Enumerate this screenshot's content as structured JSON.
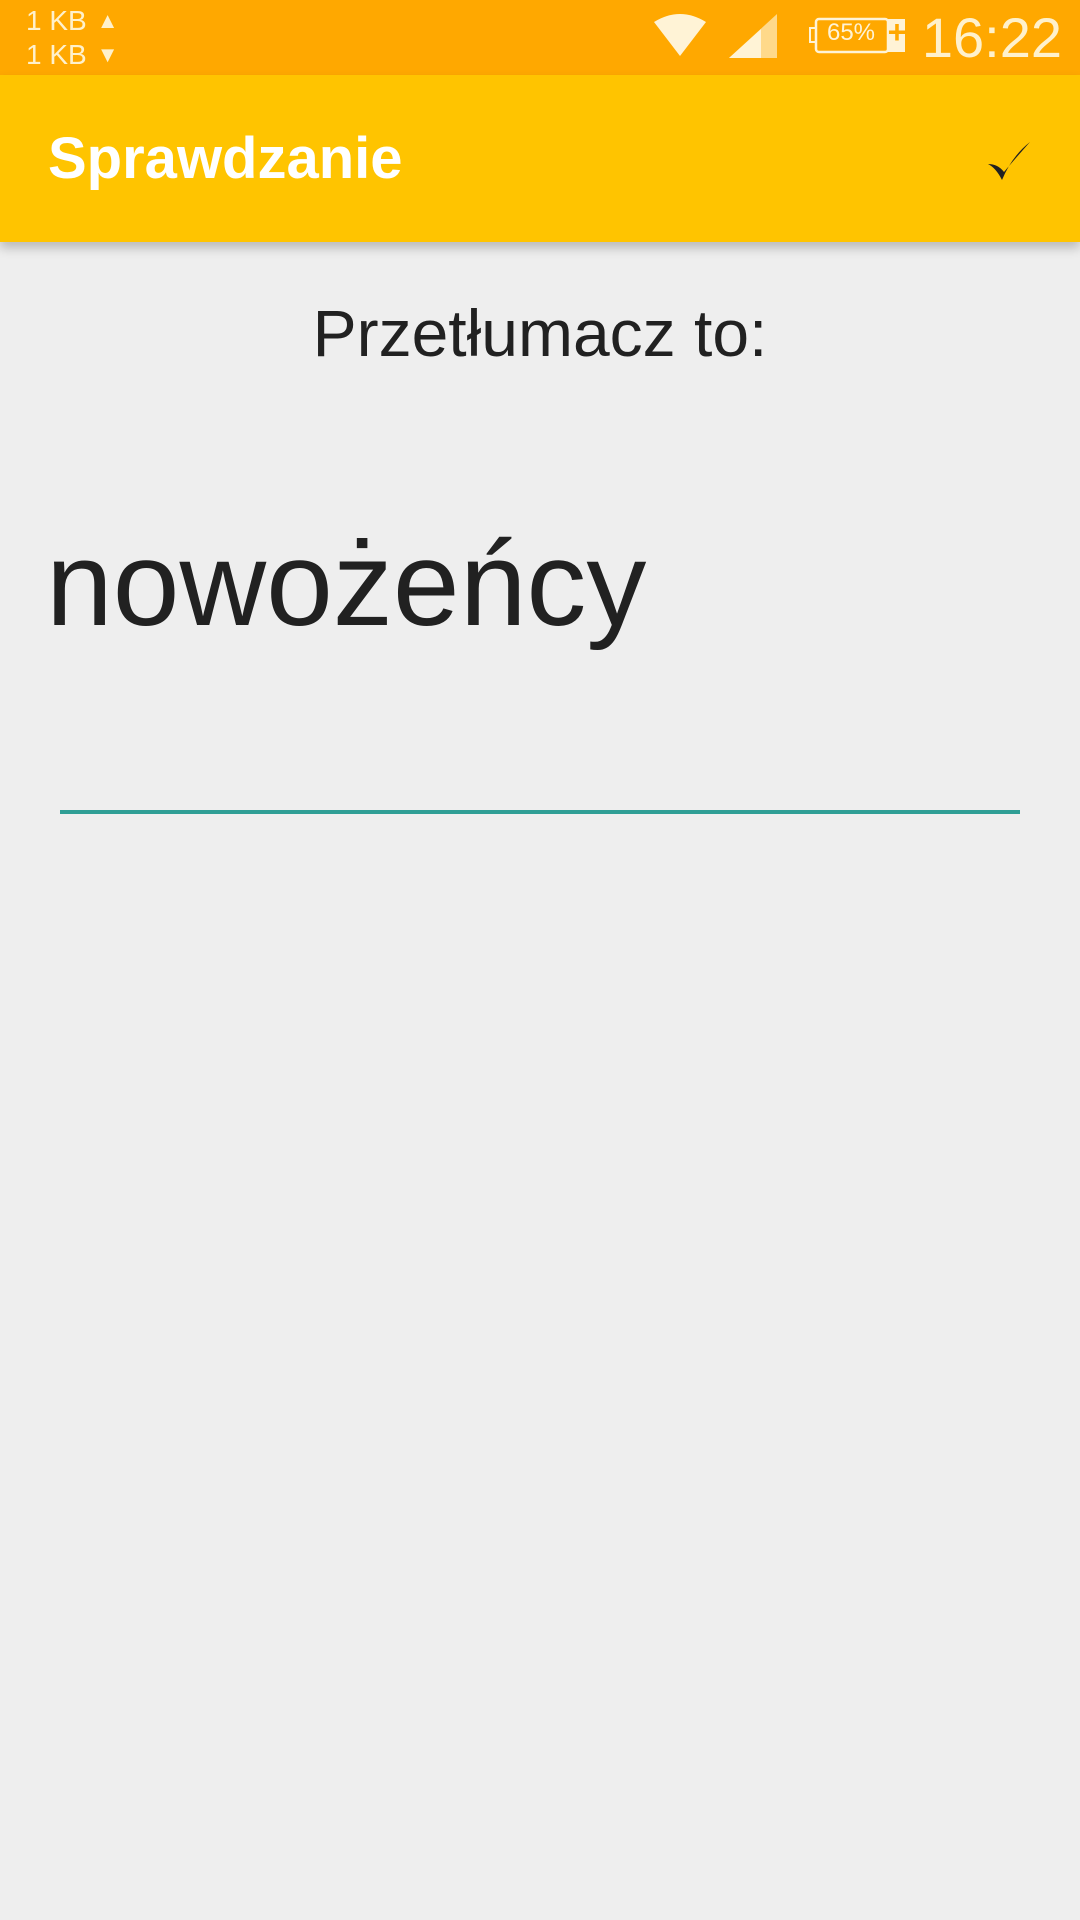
{
  "status_bar": {
    "upload_speed": "1 KB",
    "download_speed": "1 KB",
    "upload_arrow": "▲",
    "download_arrow": "▼",
    "battery_level": "65%",
    "battery_charging_symbol": "+",
    "time": "16:22",
    "icons": [
      "wifi-icon",
      "signal-icon",
      "battery-icon"
    ],
    "color": "#ffa800"
  },
  "app_bar": {
    "title": "Sprawdzanie",
    "action_icon": "checkmark-icon",
    "color": "#ffc400"
  },
  "main": {
    "prompt": "Przetłumacz to:",
    "word": "nowożeńcy",
    "answer_value": "",
    "accent_color": "#2f9e95"
  }
}
